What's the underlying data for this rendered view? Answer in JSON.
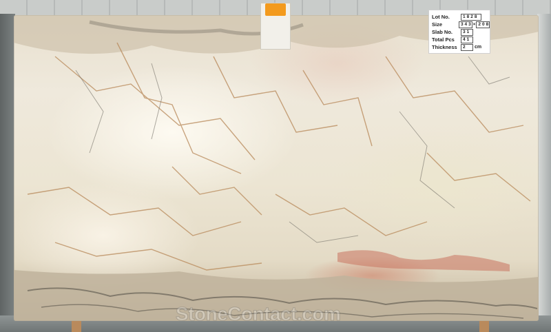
{
  "label": {
    "lot_key": "Lot No.",
    "lot_value": "1828",
    "size_key": "Size",
    "size_width": "343",
    "size_height": "208",
    "size_separator": "×",
    "slab_key": "Slab No.",
    "slab_value": "31",
    "pcs_key": "Total Pcs",
    "pcs_value": "41",
    "thickness_key": "Thickness",
    "thickness_value": "2",
    "thickness_unit": "cm"
  },
  "watermark": "StoneContact.com",
  "colors": {
    "tag_clip": "#f39a1d",
    "slab_base": "#ece5d3",
    "vein_gold": "#b8895a",
    "vein_dark": "#5d5a52",
    "rust_band": "#c9735f"
  }
}
